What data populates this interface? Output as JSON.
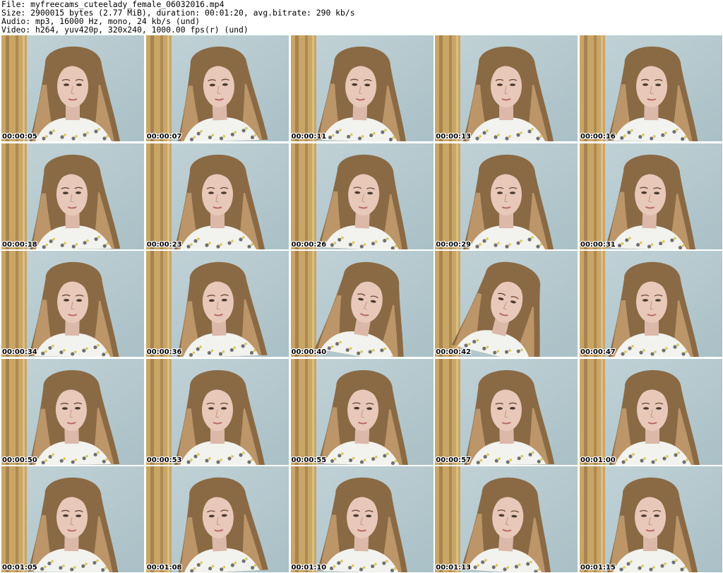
{
  "header": {
    "file_line": "File: myfreecams_cuteelady_female_06032016.mp4",
    "size_line": "Size: 2900015 bytes (2.77 MiB), duration: 00:01:20, avg.bitrate: 290 kb/s",
    "audio_line": "Audio: mp3, 16000 Hz, mono, 24 kb/s (und)",
    "video_line": "Video: h264, yuv420p, 320x240, 1000.00 fps(r) (und)"
  },
  "colors": {
    "wall": "#a9c0c6",
    "curtain": "#c9a566",
    "curtain_shadow": "#8a6a3a",
    "hair": "#8a6a45",
    "hair_light": "#c8a070",
    "skin": "#e8c8b8",
    "shirt": "#f2f2ee",
    "timestamp_text": "#000000",
    "timestamp_outline": "#ffffff"
  },
  "thumbnails": [
    {
      "timestamp": "00:00:05"
    },
    {
      "timestamp": "00:00:07"
    },
    {
      "timestamp": "00:00:11"
    },
    {
      "timestamp": "00:00:13"
    },
    {
      "timestamp": "00:00:16"
    },
    {
      "timestamp": "00:00:18"
    },
    {
      "timestamp": "00:00:23"
    },
    {
      "timestamp": "00:00:26"
    },
    {
      "timestamp": "00:00:29"
    },
    {
      "timestamp": "00:00:31"
    },
    {
      "timestamp": "00:00:34"
    },
    {
      "timestamp": "00:00:36"
    },
    {
      "timestamp": "00:00:40"
    },
    {
      "timestamp": "00:00:42"
    },
    {
      "timestamp": "00:00:47"
    },
    {
      "timestamp": "00:00:50"
    },
    {
      "timestamp": "00:00:53"
    },
    {
      "timestamp": "00:00:55"
    },
    {
      "timestamp": "00:00:57"
    },
    {
      "timestamp": "00:01:00"
    },
    {
      "timestamp": "00:01:05"
    },
    {
      "timestamp": "00:01:08"
    },
    {
      "timestamp": "00:01:10"
    },
    {
      "timestamp": "00:01:13"
    },
    {
      "timestamp": "00:01:15"
    }
  ]
}
